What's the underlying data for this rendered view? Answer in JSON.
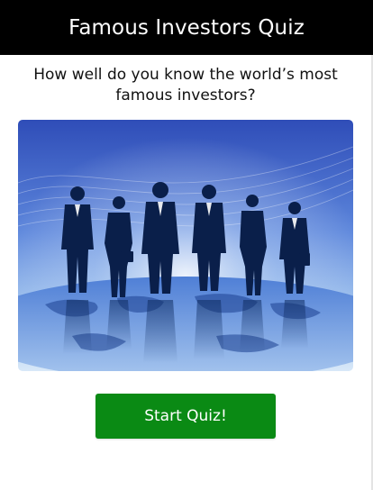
{
  "header": {
    "title": "Famous Investors Quiz"
  },
  "main": {
    "subtitle": "How well do you know the world’s most famous investors?",
    "hero_image": {
      "icon": "business-team-world-map-illustration"
    },
    "start_button": {
      "label": "Start Quiz!"
    }
  },
  "colors": {
    "header_bg": "#000000",
    "button_bg": "#0a8a14",
    "hero_sky_top": "#3a58c6",
    "hero_sky_bottom": "#dce9f8"
  }
}
